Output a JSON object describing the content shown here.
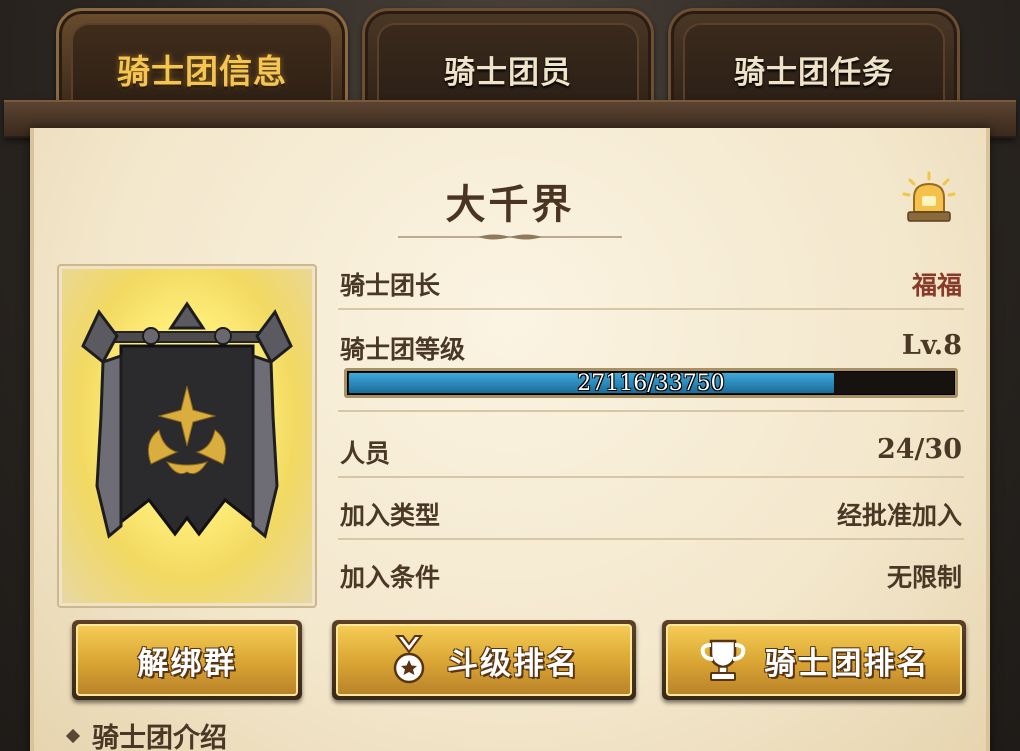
{
  "tabs": [
    {
      "label": "骑士团信息",
      "active": true
    },
    {
      "label": "骑士团员",
      "active": false
    },
    {
      "label": "骑士团任务",
      "active": false
    }
  ],
  "guild": {
    "name": "大千界",
    "rows": {
      "leader": {
        "label": "骑士团长",
        "value": "福福"
      },
      "level": {
        "label": "骑士团等级",
        "value": "Lv.8"
      },
      "members": {
        "label": "人员",
        "value": "24/30"
      },
      "join_type": {
        "label": "加入类型",
        "value": "经批准加入"
      },
      "join_condition": {
        "label": "加入条件",
        "value": "无限制"
      }
    },
    "xp": {
      "text": "27116/33750",
      "current": 27116,
      "max": 33750
    }
  },
  "buttons": {
    "unbind": "解绑群",
    "rank_level": "斗级排名",
    "rank_guild": "骑士团排名"
  },
  "intro_label": "骑士团介绍",
  "icons": {
    "notify": "alarm-bell-icon",
    "banner": "guild-banner-emblem",
    "medal": "medal-icon",
    "trophy": "trophy-icon"
  },
  "colors": {
    "tab_active_text": "#f5c451",
    "leader_name": "#8a3a2a",
    "xp_fill": "#2a8cc0",
    "button_gold": "#e0aa38"
  }
}
